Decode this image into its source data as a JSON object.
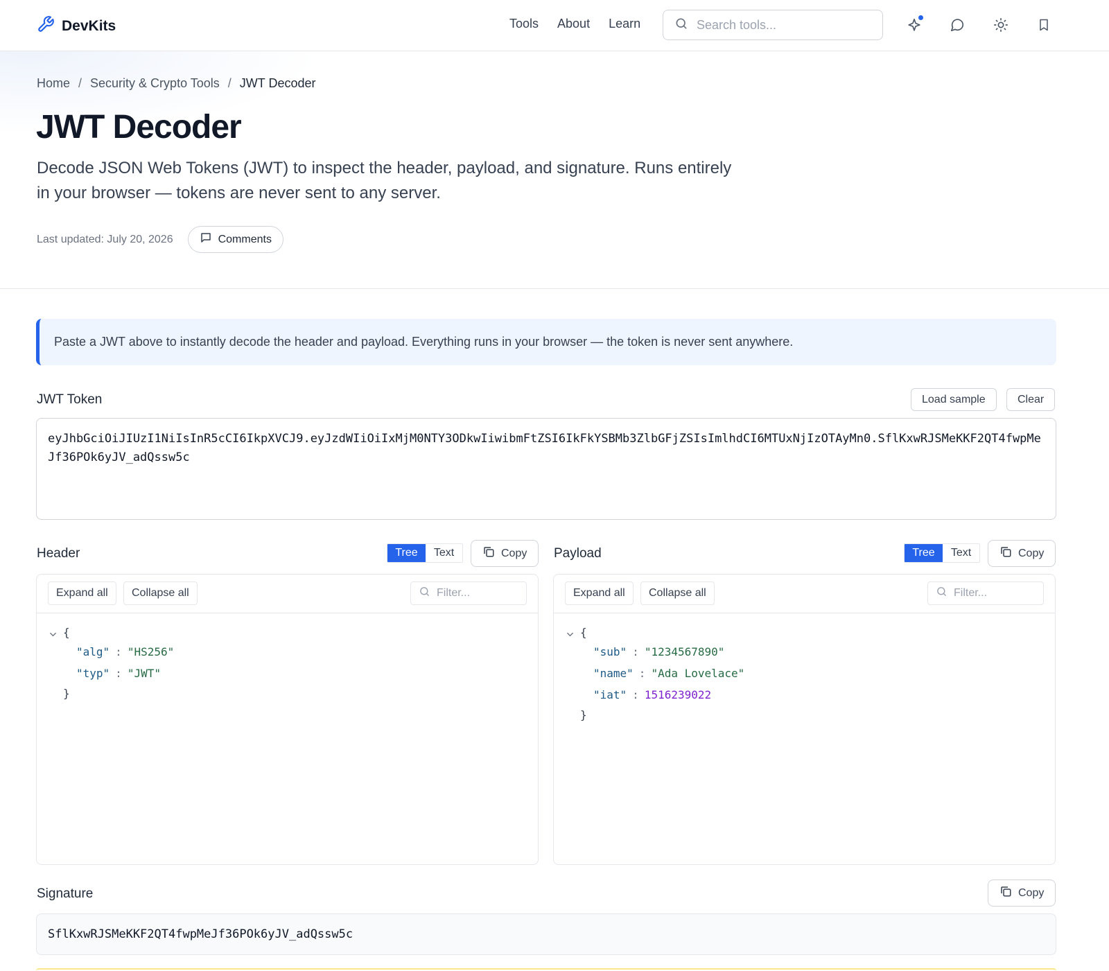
{
  "brand": {
    "name": "DevKits"
  },
  "nav": {
    "links": [
      "Tools",
      "About",
      "Learn"
    ],
    "search_placeholder": "Search tools..."
  },
  "breadcrumb": [
    "Home",
    "Security & Crypto Tools",
    "JWT Decoder"
  ],
  "page": {
    "title": "JWT Decoder",
    "description": "Decode JSON Web Tokens (JWT) to inspect the header, payload, and signature. Runs entirely in your browser — tokens are never sent to any server.",
    "last_updated": "Last updated: July 20, 2026",
    "comments_label": "Comments"
  },
  "info_banner": "Paste a JWT above to instantly decode the header and payload. Everything runs in your browser — the token is never sent anywhere.",
  "token": {
    "label": "JWT Token",
    "load_sample": "Load sample",
    "clear": "Clear",
    "value": "eyJhbGciOiJIUzI1NiIsInR5cCI6IkpXVCJ9.eyJzdWIiOiIxMjM0NTY3ODkwIiwibmFtZSI6IkFkYSBMb3ZlbGFjZSIsImlhdCI6MTUxNjIzOTAyMn0.SflKxwRJSMeKKF2QT4fwpMeJf36POk6yJV_adQssw5c"
  },
  "header_panel": {
    "label": "Header",
    "tab_tree": "Tree",
    "tab_text": "Text",
    "copy": "Copy",
    "expand_all": "Expand all",
    "collapse_all": "Collapse all",
    "filter_placeholder": "Filter...",
    "open_brace": "{",
    "close_brace": "}",
    "entries": [
      {
        "key": "\"alg\"",
        "value": "\"HS256\"",
        "type": "string"
      },
      {
        "key": "\"typ\"",
        "value": "\"JWT\"",
        "type": "string"
      }
    ]
  },
  "payload_panel": {
    "label": "Payload",
    "tab_tree": "Tree",
    "tab_text": "Text",
    "copy": "Copy",
    "expand_all": "Expand all",
    "collapse_all": "Collapse all",
    "filter_placeholder": "Filter...",
    "open_brace": "{",
    "close_brace": "}",
    "entries": [
      {
        "key": "\"sub\"",
        "value": "\"1234567890\"",
        "type": "string"
      },
      {
        "key": "\"name\"",
        "value": "\"Ada Lovelace\"",
        "type": "string"
      },
      {
        "key": "\"iat\"",
        "value": "1516239022",
        "type": "number"
      }
    ]
  },
  "signature": {
    "label": "Signature",
    "copy": "Copy",
    "value": "SflKxwRJSMeKKF2QT4fwpMeJf36POk6yJV_adQssw5c"
  },
  "colors": {
    "accent": "#2563eb",
    "json_key": "#1e5a86",
    "json_string": "#276b45",
    "json_number": "#7e22ce"
  }
}
